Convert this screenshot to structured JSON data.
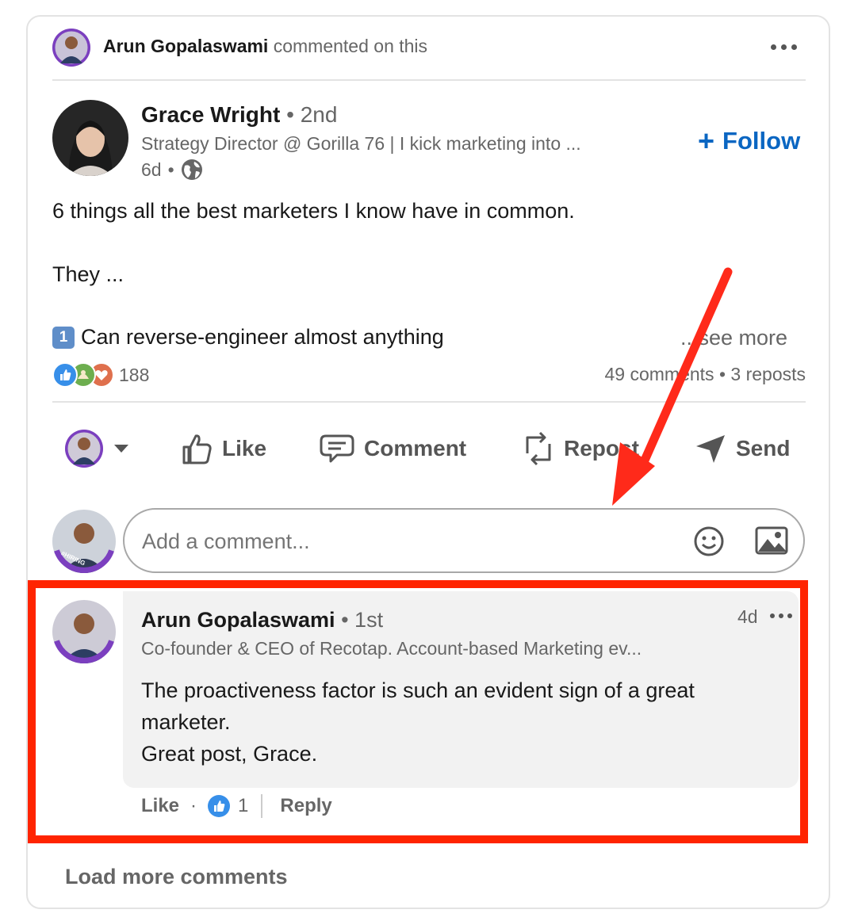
{
  "header": {
    "actor_name": "Arun Gopalaswami",
    "actor_action": "commented on this"
  },
  "post": {
    "author": {
      "name": "Grace Wright",
      "degree": "2nd",
      "headline": "Strategy Director @ Gorilla 76 | I kick marketing into ...",
      "time": "6d",
      "visibility_icon": "globe-icon"
    },
    "follow_label": "Follow",
    "body_line1": "6 things all the best marketers I know have in common.",
    "body_line2": "They ...",
    "body_line3": "Can reverse-engineer almost anything",
    "list_badge": "1",
    "see_more": "...see more",
    "reactions_count": "188",
    "comments_count": "49 comments",
    "reposts_count": "3 reposts"
  },
  "actions": {
    "like": "Like",
    "comment": "Comment",
    "repost": "Repost",
    "send": "Send"
  },
  "comment_input": {
    "placeholder": "Add a comment..."
  },
  "comment": {
    "author": "Arun Gopalaswami",
    "degree": "1st",
    "headline": "Co-founder & CEO of Recotap. Account-based Marketing ev...",
    "time": "4d",
    "text_line1": "The proactiveness factor is such an evident sign of a great",
    "text_line2": "marketer.",
    "text_line3": "Great post, Grace.",
    "like_label": "Like",
    "like_count": "1",
    "reply_label": "Reply"
  },
  "load_more": "Load more comments",
  "avatar_badge": "#HIRING",
  "colors": {
    "accent": "#0a66c2",
    "highlight": "#ff2400",
    "arrow": "#ff2a1a"
  }
}
